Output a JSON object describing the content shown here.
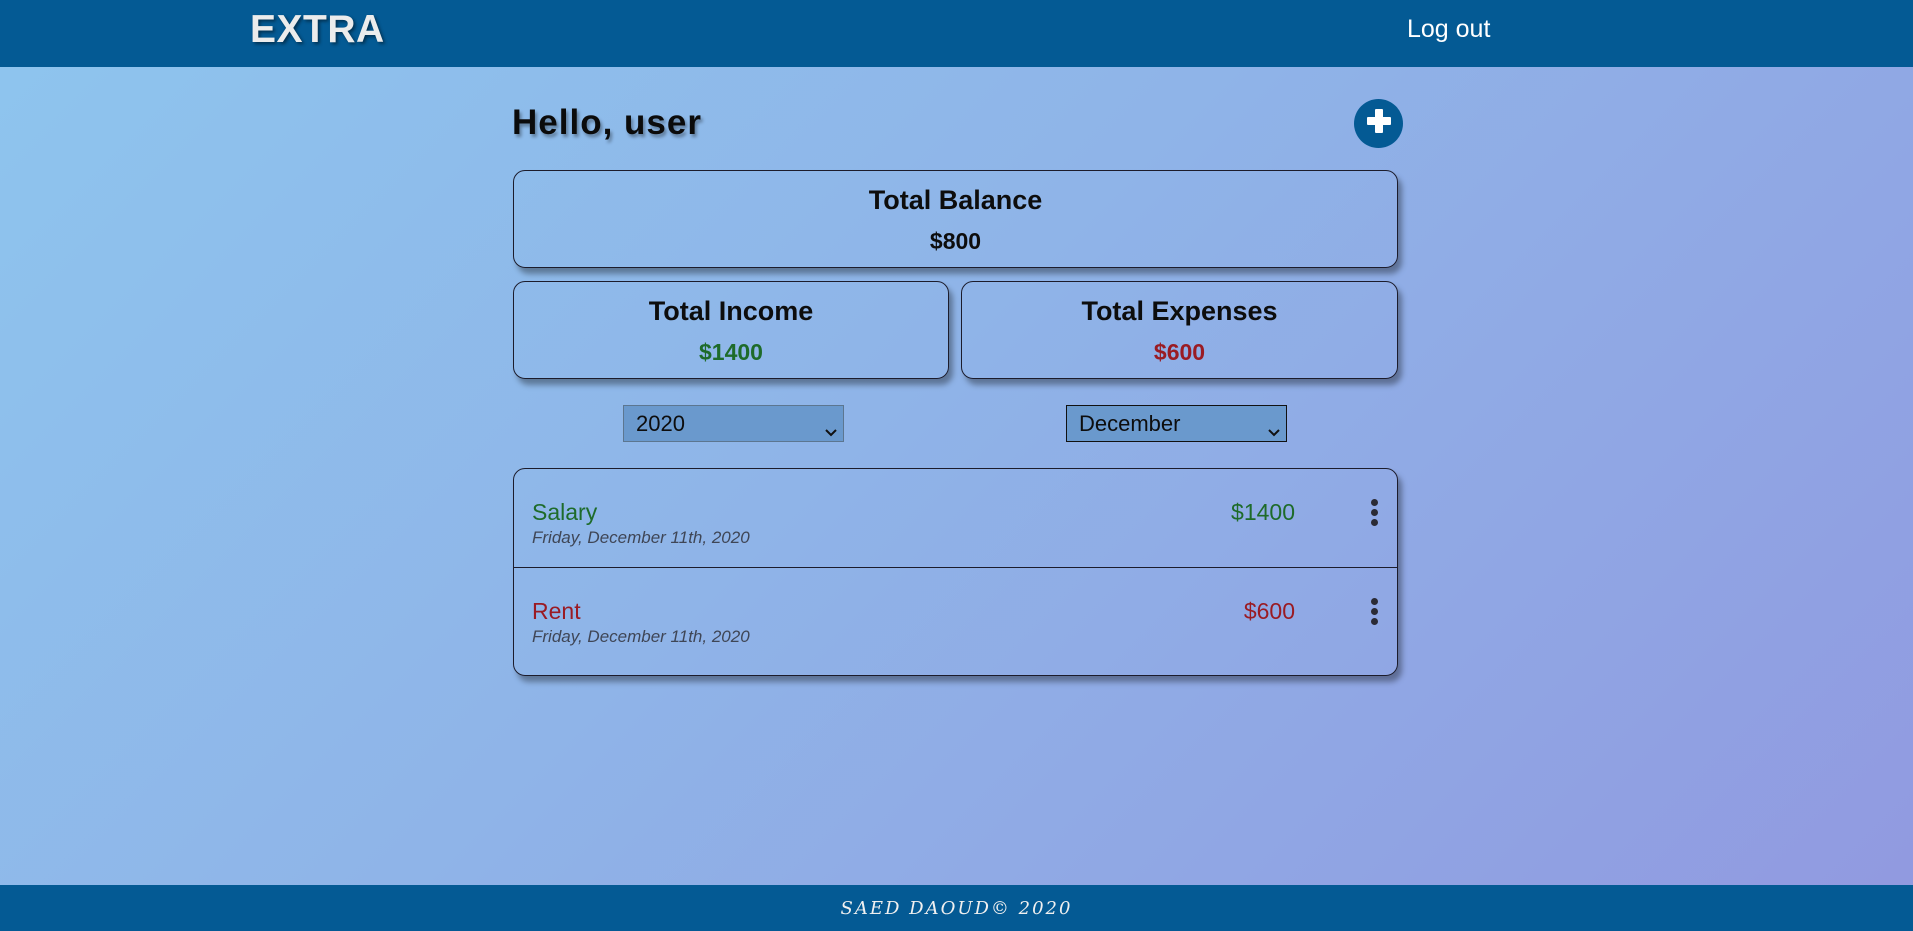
{
  "navbar": {
    "brand": "EXTRA",
    "logout_label": "Log out"
  },
  "header": {
    "greeting": "Hello, user",
    "add_icon": "plus-circle-icon"
  },
  "summary": {
    "balance": {
      "title": "Total Balance",
      "value": "$800"
    },
    "income": {
      "title": "Total Income",
      "value": "$1400"
    },
    "expenses": {
      "title": "Total Expenses",
      "value": "$600"
    }
  },
  "filters": {
    "year": {
      "selected": "2020"
    },
    "month": {
      "selected": "December"
    }
  },
  "transactions": [
    {
      "name": "Salary",
      "date": "Friday, December 11th, 2020",
      "amount": "$1400",
      "type": "income"
    },
    {
      "name": "Rent",
      "date": "Friday, December 11th, 2020",
      "amount": "$600",
      "type": "expense"
    }
  ],
  "footer": {
    "text": "SAED DAOUD© 2020"
  },
  "colors": {
    "brand": "#045a94",
    "income": "#1e6b2a",
    "expense": "#9a1b23"
  }
}
